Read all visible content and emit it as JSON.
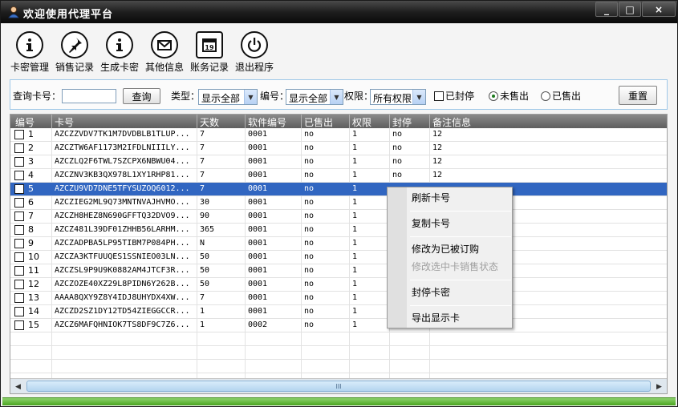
{
  "window": {
    "title": "欢迎使用代理平台",
    "buttons": {
      "minimize": "_",
      "maximize": "□",
      "close": "×"
    }
  },
  "toolbar": [
    {
      "label": "卡密管理",
      "icon": "info-icon"
    },
    {
      "label": "销售记录",
      "icon": "pin-icon"
    },
    {
      "label": "生成卡密",
      "icon": "info-icon"
    },
    {
      "label": "其他信息",
      "icon": "mail-icon"
    },
    {
      "label": "账务记录",
      "icon": "calendar-icon",
      "icon_text": "19"
    },
    {
      "label": "退出程序",
      "icon": "power-icon"
    }
  ],
  "search": {
    "card_label": "查询卡号：",
    "card_value": "",
    "query_button": "查询",
    "type_label": "类型：",
    "type_value": "显示全部",
    "code_label": "编号：",
    "code_value": "显示全部",
    "perm_label": "权限：",
    "perm_value": "所有权限",
    "blocked_label": "已封停",
    "unsold_label": "未售出",
    "sold_label": "已售出",
    "selected_radio": "未售出",
    "reset_button": "重置"
  },
  "grid": {
    "columns": [
      "编号",
      "卡号",
      "天数",
      "软件编号",
      "已售出",
      "权限",
      "封停",
      "备注信息"
    ],
    "selected_row": 4,
    "rows": [
      [
        "1",
        "AZCZZVDV7TK1M7DVDBLB1TLUP...",
        "7",
        "0001",
        "no",
        "1",
        "no",
        "12"
      ],
      [
        "2",
        "AZCZTW6AF1173M2IFDLNIIILY...",
        "7",
        "0001",
        "no",
        "1",
        "no",
        "12"
      ],
      [
        "3",
        "AZCZLQ2F6TWL7SZCPX6NBWU04...",
        "7",
        "0001",
        "no",
        "1",
        "no",
        "12"
      ],
      [
        "4",
        "AZCZNV3KB3QX978L1XY1RHP81...",
        "7",
        "0001",
        "no",
        "1",
        "no",
        "12"
      ],
      [
        "5",
        "AZCZU9VD7DNE5TFYSUZOQ6012...",
        "7",
        "0001",
        "no",
        "1",
        "",
        ""
      ],
      [
        "6",
        "AZCZIEG2ML9Q73MNTNVAJHVMO...",
        "30",
        "0001",
        "no",
        "1",
        "",
        ""
      ],
      [
        "7",
        "AZCZH8HEZ8N690GFFTQ32DVO9...",
        "90",
        "0001",
        "no",
        "1",
        "",
        ""
      ],
      [
        "8",
        "AZCZ481L39DF01ZHHB56LARHM...",
        "365",
        "0001",
        "no",
        "1",
        "",
        ""
      ],
      [
        "9",
        "AZCZADPBA5LP95TIBM7P084PH...",
        "N",
        "0001",
        "no",
        "1",
        "",
        ""
      ],
      [
        "10",
        "AZCZA3KTFUUQES1SSNIEO03LN...",
        "50",
        "0001",
        "no",
        "1",
        "",
        ""
      ],
      [
        "11",
        "AZCZSL9P9U9K0882AM4JTCF3R...",
        "50",
        "0001",
        "no",
        "1",
        "",
        ""
      ],
      [
        "12",
        "AZCZOZE40XZ29L8PIDN6Y262B...",
        "50",
        "0001",
        "no",
        "1",
        "",
        ""
      ],
      [
        "13",
        "AAAA8QXY9Z8Y4IDJ8UHYDX4XW...",
        "7",
        "0001",
        "no",
        "1",
        "",
        ""
      ],
      [
        "14",
        "AZCZD2SZ1DY12TD54ZIEGGCCR...",
        "1",
        "0001",
        "no",
        "1",
        "",
        ""
      ],
      [
        "15",
        "AZCZ6MAFQHNIOK7TS8DF9C7Z6...",
        "1",
        "0002",
        "no",
        "1",
        "",
        ""
      ]
    ]
  },
  "context_menu": [
    {
      "label": "刷新卡号",
      "enabled": true
    },
    {
      "label": "复制卡号",
      "enabled": true
    },
    {
      "label": "修改为已被订购",
      "enabled": true
    },
    {
      "label": "修改选中卡销售状态",
      "enabled": false
    },
    {
      "label": "封停卡密",
      "enabled": true
    },
    {
      "label": "导出显示卡",
      "enabled": true
    }
  ],
  "scrollbar": {
    "thumb_grip": "III"
  },
  "colors": {
    "selection": "#3166c1",
    "header": "#6e6e6e",
    "status": "#5cb82e",
    "panel_border": "#9fc8e8"
  }
}
